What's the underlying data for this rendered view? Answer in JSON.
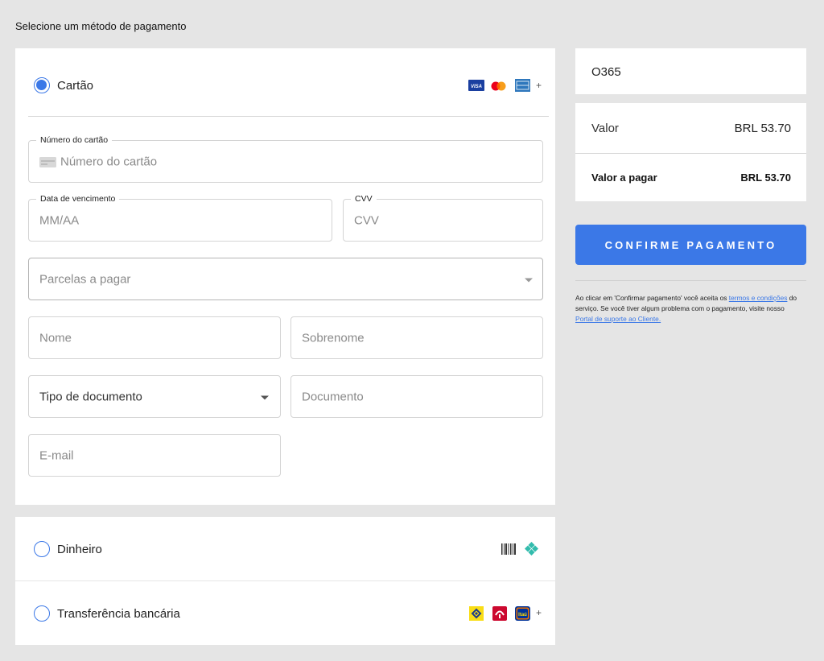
{
  "header": {
    "title": "Selecione um método de pagamento"
  },
  "methods": {
    "card": {
      "label": "Cartão",
      "more": "+",
      "icons": [
        "visa-icon",
        "mastercard-icon",
        "amex-icon"
      ]
    },
    "cash": {
      "label": "Dinheiro",
      "icons": [
        "barcode-icon",
        "pix-icon"
      ]
    },
    "bank": {
      "label": "Transferência bancária",
      "more": "+",
      "icons": [
        "banco-do-brasil-icon",
        "bradesco-icon",
        "itau-icon"
      ]
    }
  },
  "form": {
    "card_number": {
      "legend": "Número do cartão",
      "placeholder": "Número do cartão"
    },
    "expiry": {
      "legend": "Data de vencimento",
      "placeholder": "MM/AA"
    },
    "cvv": {
      "legend": "CVV",
      "placeholder": "CVV"
    },
    "installments": {
      "placeholder": "Parcelas a pagar"
    },
    "first_name": {
      "placeholder": "Nome"
    },
    "last_name": {
      "placeholder": "Sobrenome"
    },
    "doc_type": {
      "value": "Tipo de documento"
    },
    "document": {
      "placeholder": "Documento"
    },
    "email": {
      "placeholder": "E-mail"
    }
  },
  "summary": {
    "code": "O365",
    "value_label": "Valor",
    "value_amount": "BRL 53.70",
    "due_label": "Valor a pagar",
    "due_amount": "BRL 53.70"
  },
  "confirm": {
    "label": "CONFIRME PAGAMENTO"
  },
  "terms": {
    "part1": "Ao clicar em 'Confirmar pagamento' você aceita os ",
    "link1": "termos e condições",
    "part2": " do serviço. Se você tiver algum problema com o pagamento, visite nosso ",
    "link2": "Portal de suporte ao Cliente."
  },
  "colors": {
    "accent": "#3b78e7",
    "background": "#e5e5e5"
  }
}
